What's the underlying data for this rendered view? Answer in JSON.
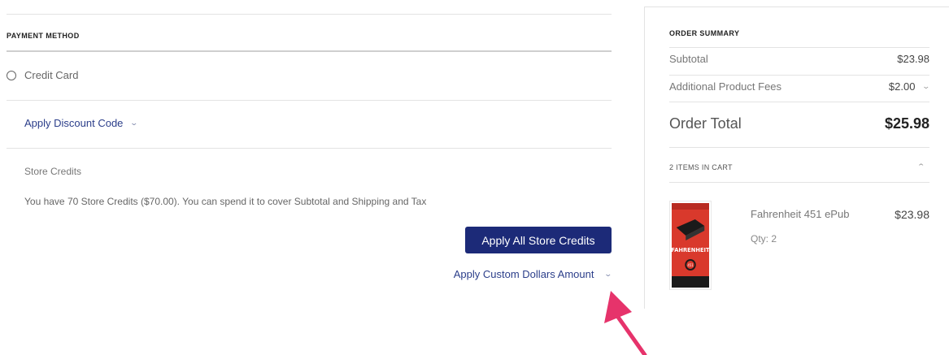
{
  "payment": {
    "section_title": "PAYMENT METHOD",
    "credit_card_label": "Credit Card",
    "discount_toggle_label": "Apply Discount Code",
    "store_credits": {
      "title": "Store Credits",
      "info": "You have 70 Store Credits ($70.00). You can spend it to cover Subtotal and Shipping and Tax",
      "apply_all_label": "Apply All Store Credits",
      "custom_amount_label": "Apply Custom Dollars Amount"
    }
  },
  "icons": {
    "chevron_down": "chevron-down-icon",
    "chevron_up": "chevron-up-icon",
    "annotation_arrow": "arrow-icon"
  },
  "colors": {
    "primary_button": "#1c2a78",
    "link": "#2b3e8a",
    "annotation_arrow": "#e6336b"
  },
  "summary": {
    "title": "ORDER SUMMARY",
    "subtotal_label": "Subtotal",
    "subtotal_value": "$23.98",
    "fees_label": "Additional Product Fees",
    "fees_value": "$2.00",
    "total_label": "Order Total",
    "total_value": "$25.98",
    "cart_heading": "2 ITEMS IN CART",
    "item": {
      "name": "Fahrenheit 451 ePub",
      "qty": "Qty: 2",
      "price": "$23.98",
      "cover_title": "FAHRENHEIT",
      "cover_number": "451"
    }
  }
}
